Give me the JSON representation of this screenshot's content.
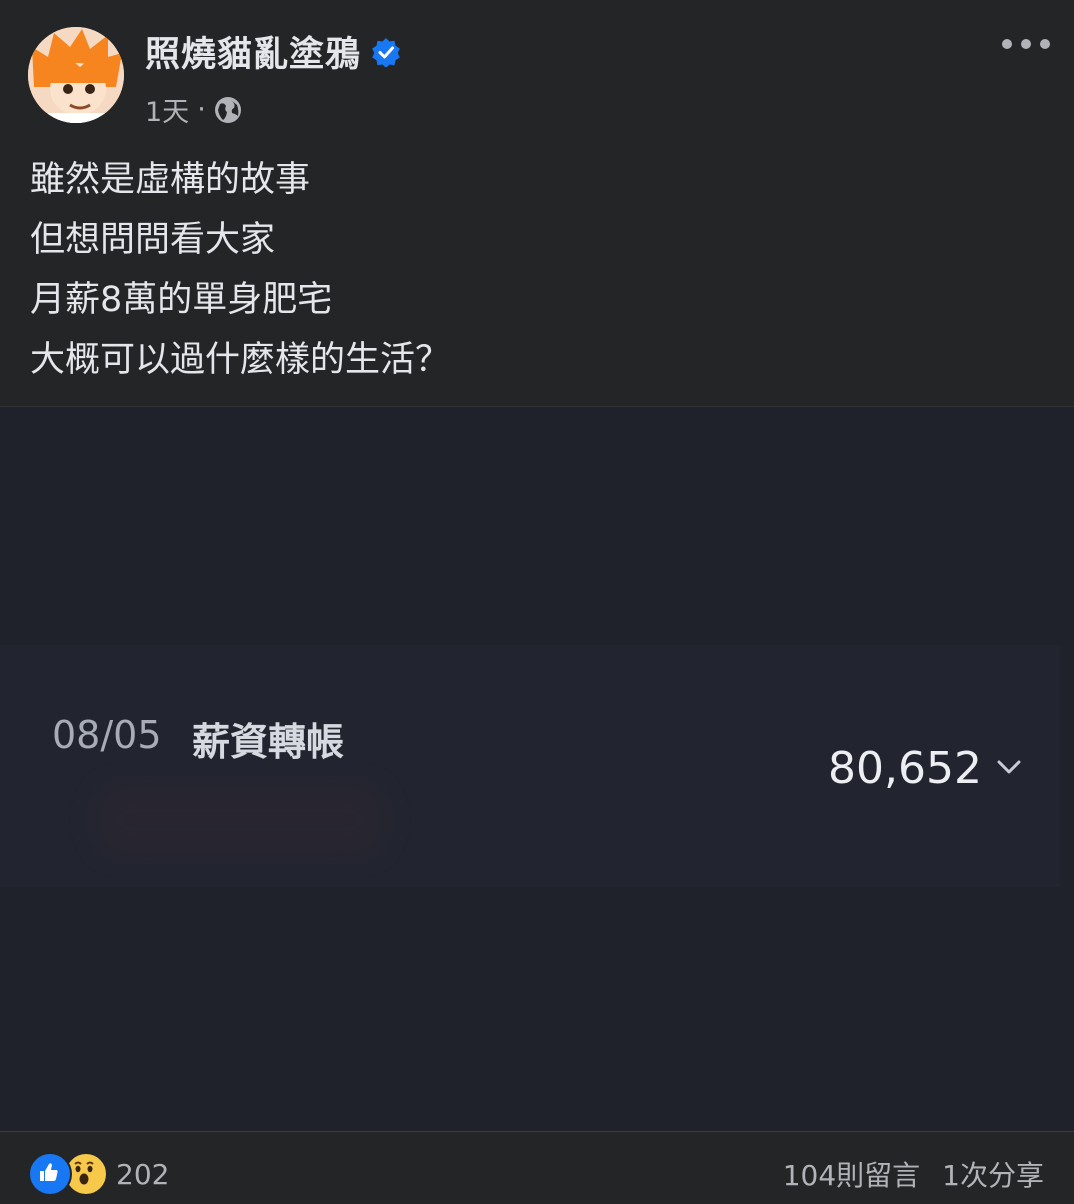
{
  "author": {
    "name": "照燒貓亂塗鴉",
    "verified_icon": "verified-badge-icon",
    "avatar_icon": "avatar-cartoon-orange-hair"
  },
  "meta": {
    "time": "1天",
    "separator": "·",
    "audience_icon": "globe-icon"
  },
  "post": {
    "lines": [
      "雖然是虛構的故事",
      "但想問問看大家",
      "月薪8萬的單身肥宅",
      "大概可以過什麼樣的生活？"
    ]
  },
  "transaction": {
    "date": "08/05",
    "description": "薪資轉帳",
    "amount": "80,652",
    "expand_icon": "chevron-down-icon"
  },
  "footer": {
    "reaction_icons": [
      "like-icon",
      "wow-icon"
    ],
    "reaction_count": "202",
    "comments": "104則留言",
    "shares": "1次分享"
  },
  "colors": {
    "background": "#242526",
    "media_background": "#1f222b",
    "accent": "#1877f2",
    "text_primary": "#e4e6eb",
    "text_secondary": "#b0b3b8"
  }
}
